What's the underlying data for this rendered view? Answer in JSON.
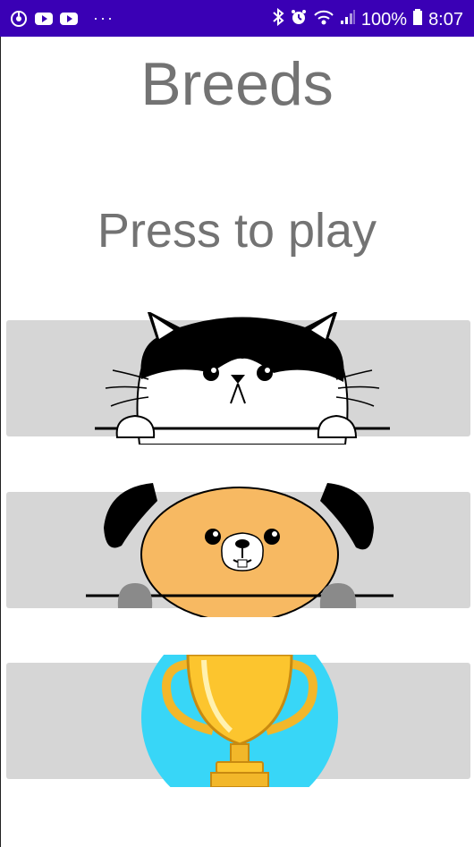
{
  "status_bar": {
    "battery_text": "100%",
    "time": "8:07",
    "left_icons": [
      "power-circle-icon",
      "youtube-icon",
      "youtube-icon",
      "more-dots-icon"
    ],
    "right_icons": [
      "bluetooth-icon",
      "alarm-icon",
      "wifi-icon",
      "signal-icon",
      "battery-icon"
    ],
    "background_color": "#3a00b5"
  },
  "main": {
    "title": "Breeds",
    "subtitle": "Press to play",
    "text_color": "#737373",
    "buttons": [
      {
        "name": "cat-button",
        "icon": "cat-face-icon"
      },
      {
        "name": "dog-button",
        "icon": "dog-face-icon"
      },
      {
        "name": "trophy-button",
        "icon": "trophy-icon"
      }
    ],
    "button_color": "#d6d6d6"
  }
}
